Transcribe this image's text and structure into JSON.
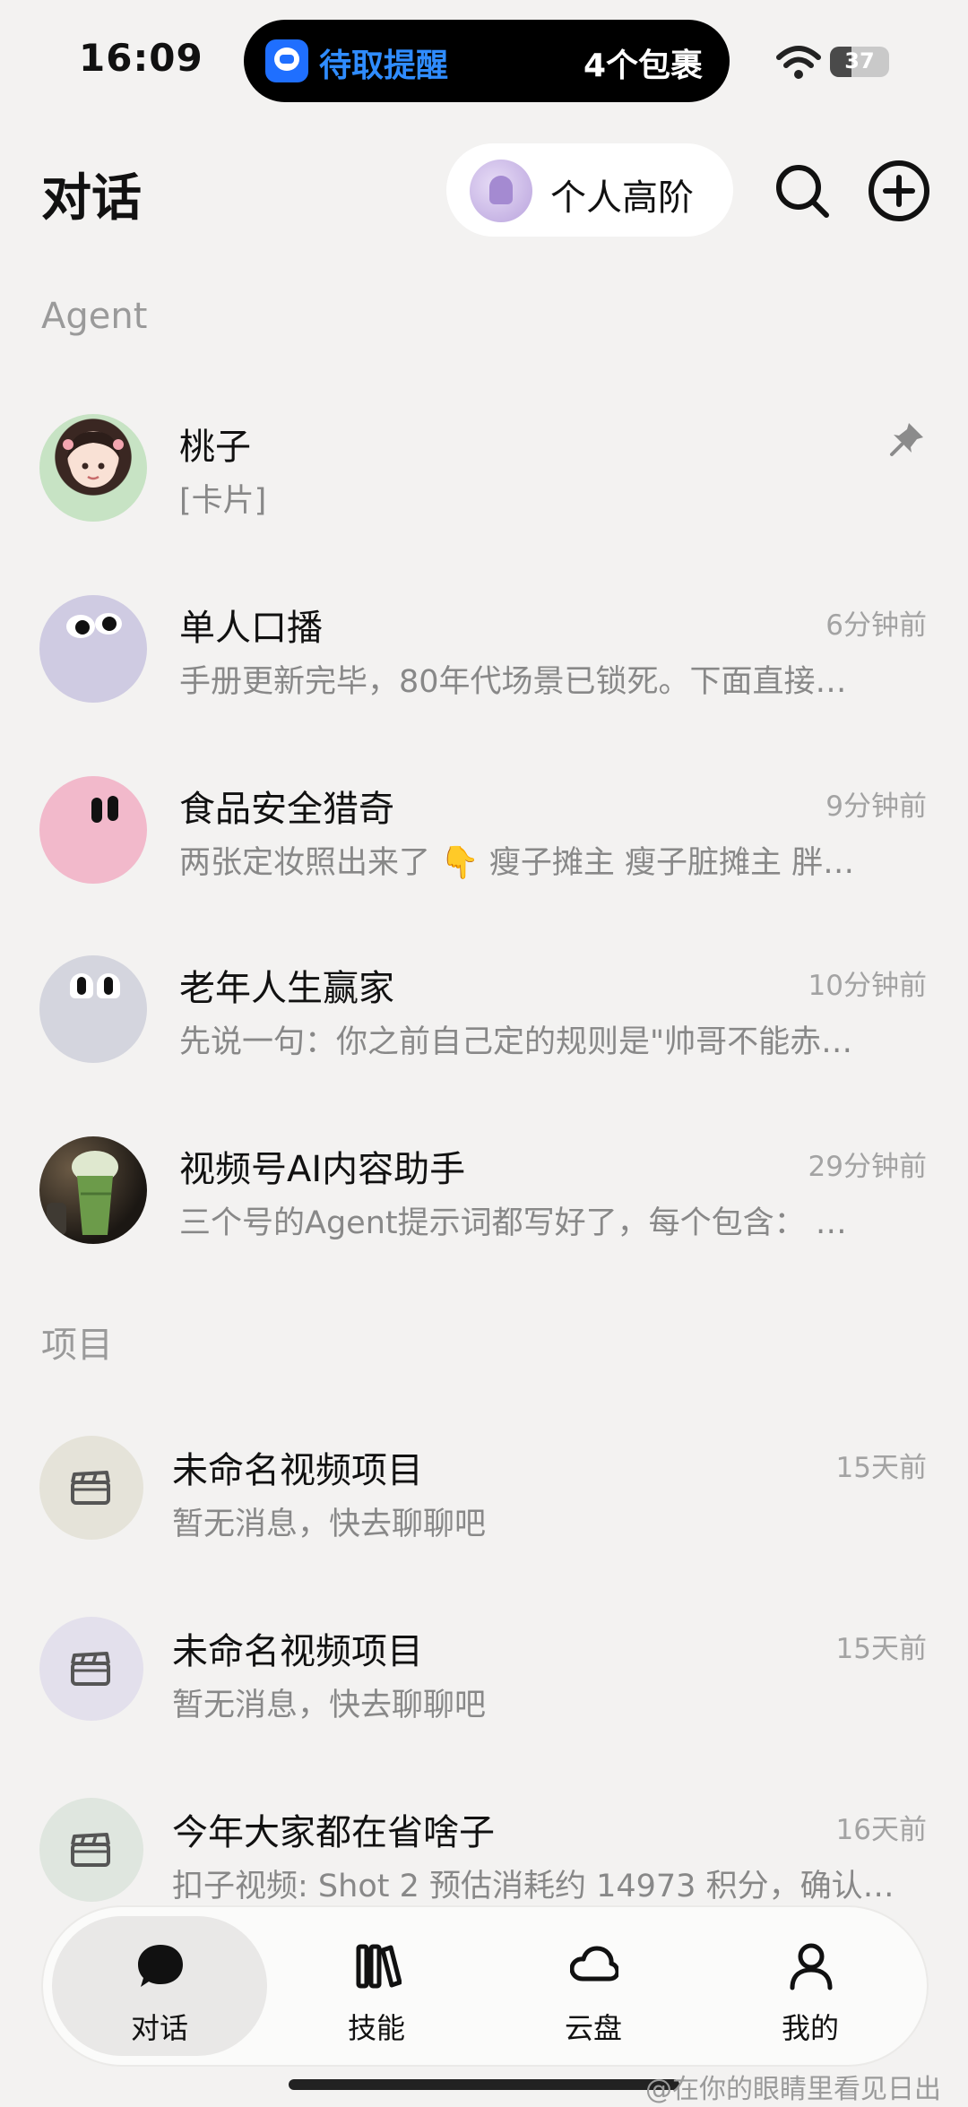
{
  "status_bar": {
    "time": "16:09",
    "island": {
      "title": "待取提醒",
      "count": "4个包裹"
    },
    "battery": {
      "level": 37,
      "label": "37"
    }
  },
  "header": {
    "title": "对话",
    "plan_label": "个人高阶"
  },
  "sections": {
    "agent_label": "Agent",
    "project_label": "项目"
  },
  "agents": [
    {
      "name": "桃子",
      "preview": "[卡片]",
      "time": "",
      "pinned": true
    },
    {
      "name": "单人口播",
      "preview": "手册更新完毕，80年代场景已锁死。下面直接…",
      "time": "6分钟前"
    },
    {
      "name": "食品安全猎奇",
      "preview": "两张定妆照出来了 👇 瘦子摊主 瘦子脏摊主 胖…",
      "time": "9分钟前"
    },
    {
      "name": "老年人生赢家",
      "preview": "先说一句：你之前自己定的规则是\"帅哥不能赤…",
      "time": "10分钟前"
    },
    {
      "name": "视频号AI内容助手",
      "preview": "三个号的Agent提示词都写好了，每个包含：  …",
      "time": "29分钟前"
    }
  ],
  "projects": [
    {
      "name": "未命名视频项目",
      "preview": "暂无消息，快去聊聊吧",
      "time": "15天前",
      "color": "#e5e3d9"
    },
    {
      "name": "未命名视频项目",
      "preview": "暂无消息，快去聊聊吧",
      "time": "15天前",
      "color": "#e3e0ec"
    },
    {
      "name": "今年大家都在省啥子",
      "preview": "扣子视频: Shot 2 预估消耗约 14973 积分，确认…",
      "time": "16天前",
      "color": "#dfe6df"
    }
  ],
  "tabbar": {
    "tabs": [
      {
        "label": "对话",
        "icon": "chat-bubble-icon",
        "active": true
      },
      {
        "label": "技能",
        "icon": "books-icon",
        "active": false
      },
      {
        "label": "云盘",
        "icon": "cloud-icon",
        "active": false
      },
      {
        "label": "我的",
        "icon": "person-icon",
        "active": false
      }
    ]
  },
  "watermark": "@在你的眼睛里看见日出"
}
